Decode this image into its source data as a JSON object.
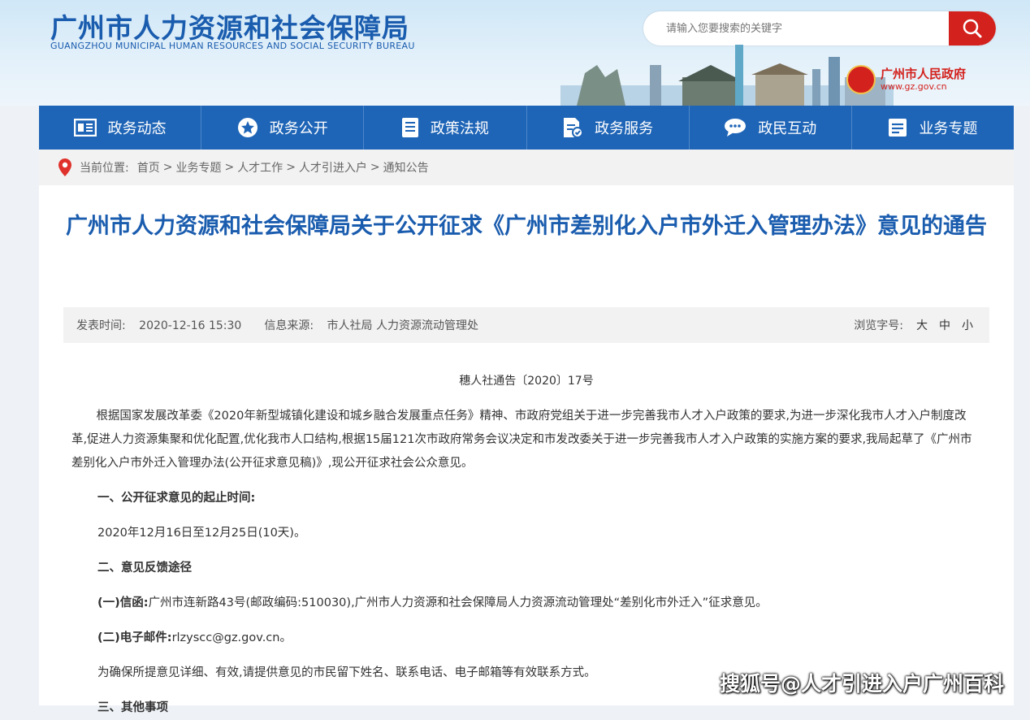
{
  "header": {
    "title_cn": "广州市人力资源和社会保障局",
    "title_en": "GUANGZHOU MUNICIPAL HUMAN RESOURCES AND SOCIAL SECURITY BUREAU",
    "search_placeholder": "请输入您要搜索的关键字",
    "gov_name": "广州市人民政府",
    "gov_url": "www.gz.gov.cn"
  },
  "nav": [
    {
      "label": "政务动态",
      "icon": "newspaper-icon"
    },
    {
      "label": "政务公开",
      "icon": "star-circle-icon"
    },
    {
      "label": "政策法规",
      "icon": "document-list-icon"
    },
    {
      "label": "政务服务",
      "icon": "service-doc-icon"
    },
    {
      "label": "政民互动",
      "icon": "chat-bubble-icon"
    },
    {
      "label": "业务专题",
      "icon": "topic-list-icon"
    }
  ],
  "breadcrumb": {
    "label": "当前位置:",
    "items": [
      "首页",
      "业务专题",
      "人才工作",
      "人才引进入户",
      "通知公告"
    ],
    "separator": ">"
  },
  "article": {
    "title": "广州市人力资源和社会保障局关于公开征求《广州市差别化入户市外迁入管理办法》意见的通告",
    "publish_label": "发表时间:",
    "publish_time": "2020-12-16 15:30",
    "source_label": "信息来源:",
    "source": "市人社局 人力资源流动管理处",
    "font_size_label": "浏览字号:",
    "font_sizes": [
      "大",
      "中",
      "小"
    ],
    "doc_number": "穗人社通告〔2020〕17号",
    "intro": "根据国家发展改革委《2020年新型城镇化建设和城乡融合发展重点任务》精神、市政府党组关于进一步完善我市人才入户政策的要求,为进一步深化我市人才入户制度改革,促进人力资源集聚和优化配置,优化我市人口结构,根据15届121次市政府常务会议决定和市发改委关于进一步完善我市人才入户政策的实施方案的要求,我局起草了《广州市差别化入户市外迁入管理办法(公开征求意见稿)》,现公开征求社会公众意见。",
    "section1_heading": "一、公开征求意见的起止时间:",
    "section1_text": "2020年12月16日至12月25日(10天)。",
    "section2_heading": "二、意见反馈途径",
    "letter_label": "(一)信函:",
    "letter_text": "广州市连新路43号(邮政编码:510030),广州市人力资源和社会保障局人力资源流动管理处“差别化市外迁入”征求意见。",
    "email_label": "(二)电子邮件:",
    "email_text": "rlzyscc@gz.gov.cn。",
    "note": "为确保所提意见详细、有效,请提供意见的市民留下姓名、联系电话、电子邮箱等有效联系方式。",
    "section3_heading": "三、其他事项"
  },
  "watermark": "搜狐号@人才引进入户广州百科",
  "colors": {
    "brand_blue": "#1f65b7",
    "title_blue": "#1a5cae",
    "search_red": "#d3211d"
  }
}
